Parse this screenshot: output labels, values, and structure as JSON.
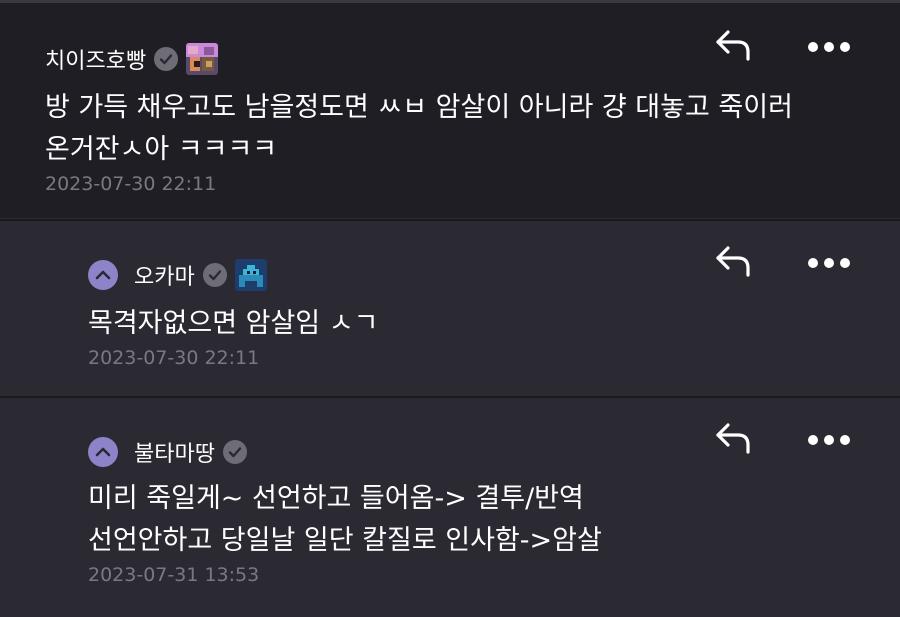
{
  "comments": [
    {
      "author": "치이즈호빵",
      "text_lines": [
        "방 가득 채우고도 남을정도면 ㅆㅂ 암살이 아니라 걍 대놓고 죽이러",
        "온거잔ㅅ아 ㅋㅋㅋㅋ"
      ],
      "timestamp": "2023-07-30 22:11",
      "icons": {
        "verified": "verified-check-icon",
        "avatar": "user-avatar-image",
        "reply": "reply-arrow-icon",
        "more": "more-dots-icon"
      }
    },
    {
      "author": "오카마",
      "text_lines": [
        "목격자없으면 암살임 ㅅㄱ"
      ],
      "timestamp": "2023-07-30 22:11",
      "icons": {
        "collapse": "chevron-up-icon",
        "verified": "verified-check-icon",
        "avatar": "pixel-avatar-image",
        "reply": "reply-arrow-icon",
        "more": "more-dots-icon"
      }
    },
    {
      "author": "불타마땅",
      "text_lines": [
        "미리 죽일게~ 선언하고 들어옴-> 결투/반역",
        "선언안하고 당일날 일단 칼질로 인사함->암살"
      ],
      "timestamp": "2023-07-31 13:53",
      "icons": {
        "collapse": "chevron-up-icon",
        "verified": "verified-check-icon",
        "reply": "reply-arrow-icon",
        "more": "more-dots-icon"
      }
    }
  ],
  "colors": {
    "background": "#2b2a33",
    "top_comment_bg": "#1f1e24",
    "accent": "#8c83c9",
    "timestamp": "#7a7982"
  }
}
